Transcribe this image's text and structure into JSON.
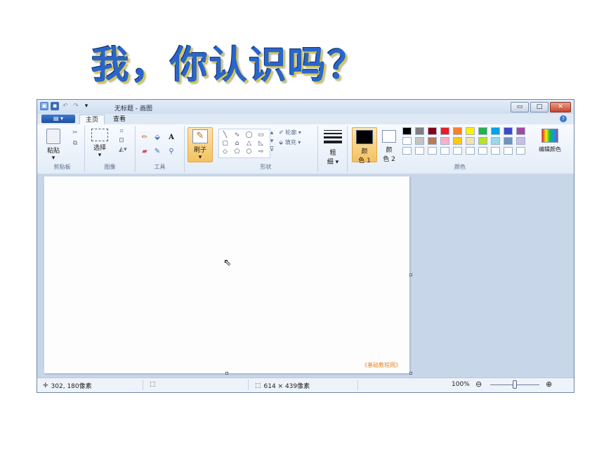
{
  "slide": {
    "title": "我，你认识吗？"
  },
  "window": {
    "title": "无标题 - 画图",
    "qat_icons": [
      "paint-app-icon",
      "save-icon",
      "undo-icon",
      "redo-icon",
      "dropdown-icon"
    ],
    "controls": {
      "minimize": "▭",
      "maximize": "□",
      "close": "✕"
    }
  },
  "tabs": {
    "file": "▤ ▾",
    "home": "主页",
    "view": "查看"
  },
  "ribbon": {
    "clipboard": {
      "label": "剪贴板",
      "paste": "粘贴",
      "paste_arrow": "▾",
      "cut_icon": "✂",
      "copy_icon": "⧉"
    },
    "image": {
      "label": "图像",
      "select": "选择",
      "select_arrow": "▾",
      "crop_icon": "⌗",
      "resize_icon": "⊡",
      "rotate_icon": "◭▾"
    },
    "tools": {
      "label": "工具",
      "pencil": "✏",
      "fill": "⬙",
      "text": "A",
      "eraser": "▰",
      "picker": "✎",
      "magnifier": "⚲"
    },
    "brushes": {
      "label": "刷子",
      "arrow": "▾"
    },
    "shapes": {
      "label": "形状",
      "outline": "轮廓 ▾",
      "fill": "填充 ▾",
      "items": [
        "╲",
        "∿",
        "◯",
        "▭",
        "▢",
        "⌂",
        "△",
        "◺",
        "◇",
        "⬠",
        "⬡",
        "⇨"
      ]
    },
    "size": {
      "label_1": "粗",
      "label_2": "细 ▾"
    },
    "colors": {
      "label": "颜色",
      "color1_a": "颜",
      "color1_b": "色 1",
      "color2_a": "颜",
      "color2_b": "色 2",
      "edit": "编辑颜色",
      "color1": "#000000",
      "color2": "#ffffff",
      "row1": [
        "#000000",
        "#7f7f7f",
        "#880015",
        "#ed1c24",
        "#ff7f27",
        "#fff200",
        "#22b14c",
        "#00a2e8",
        "#3f48cc",
        "#a349a4"
      ],
      "row2": [
        "#ffffff",
        "#c3c3c3",
        "#b97a57",
        "#ffaec9",
        "#ffc90e",
        "#efe4b0",
        "#b5e61d",
        "#99d9ea",
        "#7092be",
        "#c8bfe7"
      ],
      "row3": [
        "#ffffff",
        "#ffffff",
        "#ffffff",
        "#ffffff",
        "#ffffff",
        "#ffffff",
        "#ffffff",
        "#ffffff",
        "#ffffff",
        "#ffffff"
      ]
    }
  },
  "canvas": {
    "watermark": "《基础教程网》"
  },
  "status": {
    "cursor_pos": "302, 180像素",
    "selection_size": "",
    "canvas_size": "614 × 439像素",
    "zoom": "100%",
    "zoom_level": 0.5
  }
}
